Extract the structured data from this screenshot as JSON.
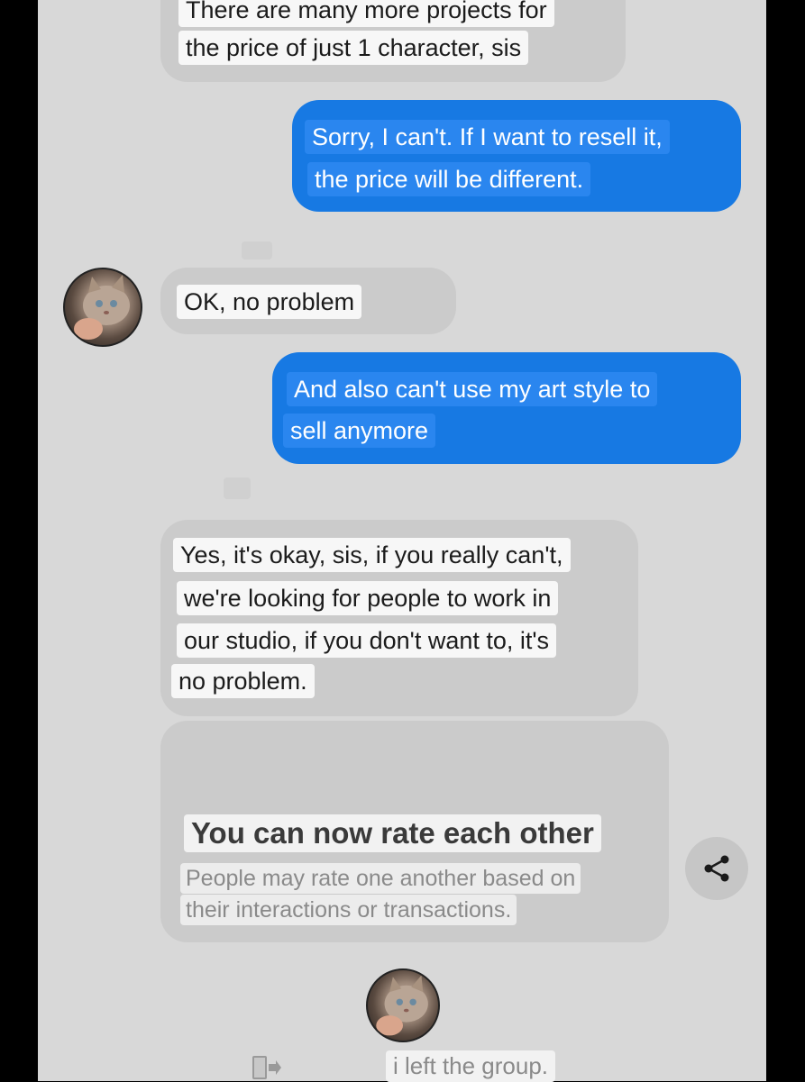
{
  "messages": [
    {
      "direction": "incoming",
      "lines": [
        "There are many more projects for",
        "the price of just 1 character, sis"
      ]
    },
    {
      "direction": "outgoing",
      "lines": [
        "Sorry, I can't. If I want to resell it,",
        "the price will be different."
      ]
    },
    {
      "direction": "incoming",
      "lines": [
        "OK, no problem"
      ]
    },
    {
      "direction": "outgoing",
      "lines": [
        "And also can't use my art style to",
        "sell anymore"
      ]
    },
    {
      "direction": "incoming",
      "lines": [
        "Yes, it's okay, sis, if you really can't,",
        "we're looking for people to work in",
        "our studio, if you don't want to, it's",
        "no problem."
      ]
    }
  ],
  "rating_card": {
    "title": "You can now rate each other",
    "subtitle_lines": [
      "People may rate one another based on",
      "their interactions or transactions."
    ]
  },
  "system_message": "i left the group.",
  "icons": {
    "avatar": "kitten-avatar",
    "share": "share-icon",
    "leave": "leave-group-icon"
  },
  "colors": {
    "outgoing_bubble": "#1779e3",
    "incoming_bubble": "#cbcbcb",
    "background": "#d8d8d8"
  }
}
